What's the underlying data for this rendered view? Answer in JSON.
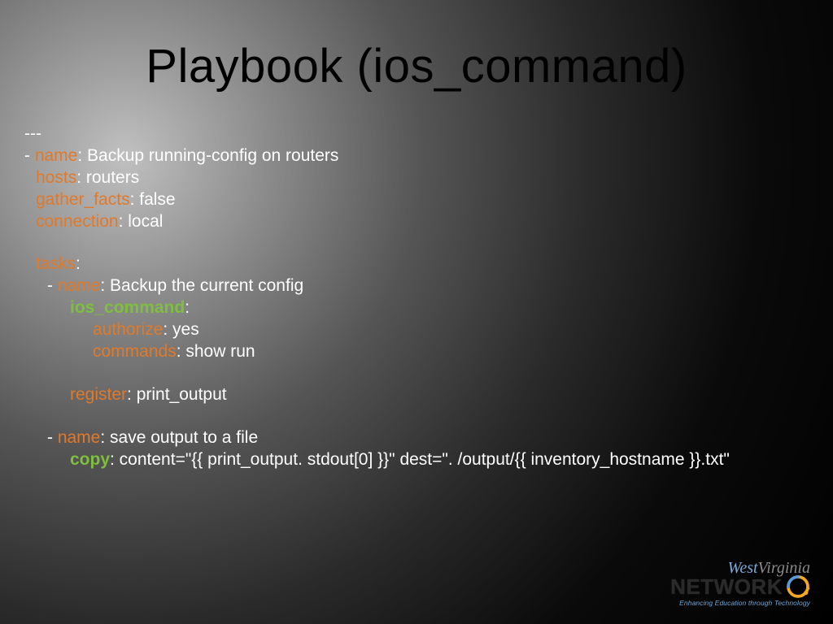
{
  "title": "Playbook (ios_command)",
  "code": {
    "l0": "---",
    "l1a": "- ",
    "l1k": "name",
    "l1v": ": Backup running-config on routers",
    "l2k": "hosts",
    "l2v": ": routers",
    "l3k": "gather_facts",
    "l3v": ": false",
    "l4k": "connection",
    "l4v": ": local",
    "l5k": "tasks",
    "l5v": ":",
    "l6a": "- ",
    "l6k": "name",
    "l6v": ": Backup the current config",
    "l7k": "ios_command",
    "l7v": ":",
    "l8k": "authorize",
    "l8v": ": yes",
    "l9k": "commands",
    "l9v": ": show run",
    "l10k": "register",
    "l10v": ": print_output",
    "l11a": "- ",
    "l11k": "name",
    "l11v": ": save output to a file",
    "l12k": "copy",
    "l12v": ": content=\"{{ print_output. stdout[0] }}\" dest=\". /output/{{ inventory_hostname }}.txt\""
  },
  "logo": {
    "west": "West",
    "virginia": "Virginia",
    "network": "NETWORK",
    "tagline": "Enhancing Education through Technology"
  }
}
